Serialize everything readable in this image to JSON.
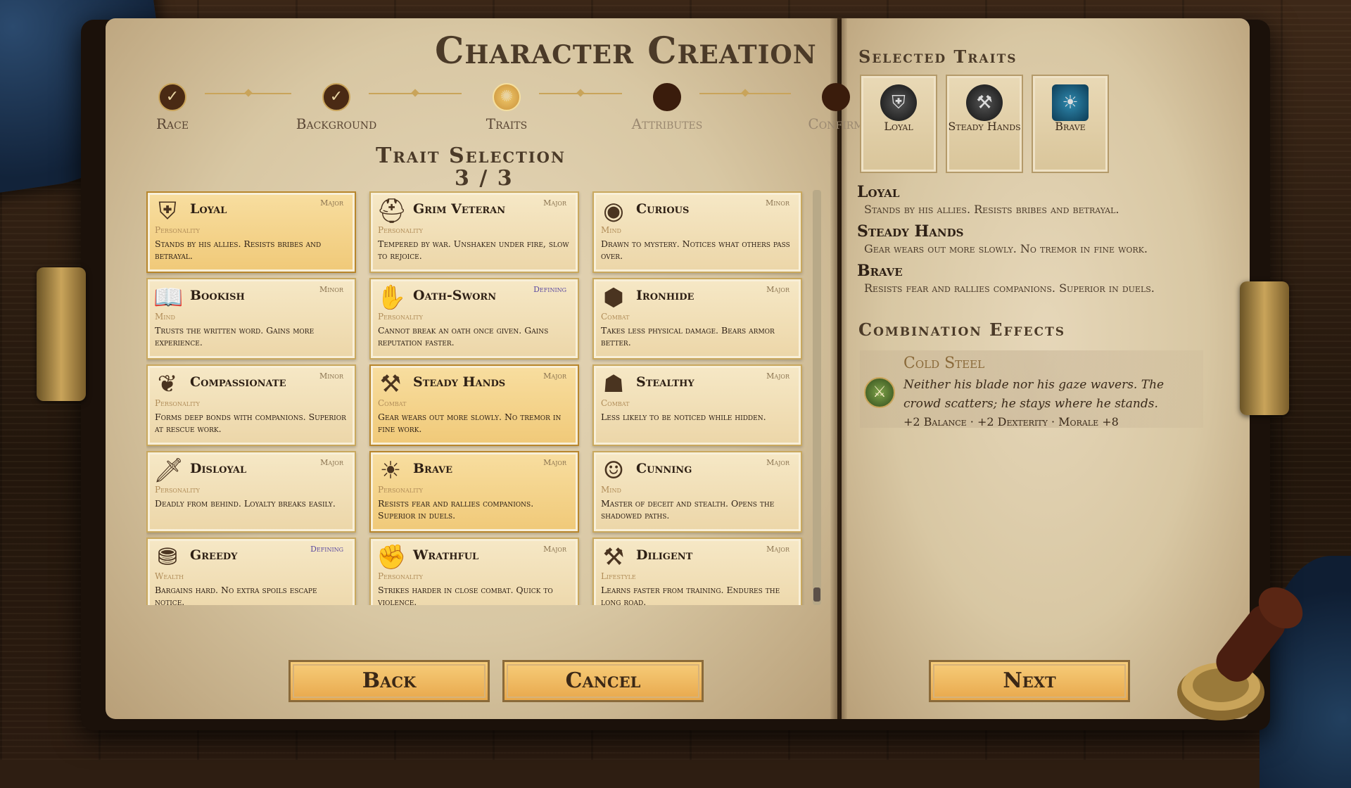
{
  "title": "Character Creation",
  "steps": [
    {
      "label": "Race",
      "state": "done",
      "mark": "✓"
    },
    {
      "label": "Background",
      "state": "done",
      "mark": "✓"
    },
    {
      "label": "Traits",
      "state": "active",
      "mark": "✺"
    },
    {
      "label": "Attributes",
      "state": "todo",
      "mark": ""
    },
    {
      "label": "Confirm",
      "state": "todo",
      "mark": ""
    }
  ],
  "trait_selection": {
    "heading": "Trait Selection",
    "count": "3 / 3"
  },
  "traits": [
    {
      "name": "Loyal",
      "weight": "Major",
      "category": "Personality",
      "desc": "Stands by his allies. Resists bribes and betrayal.",
      "icon": "shield-cross-icon",
      "glyph": "⛨",
      "selected": true
    },
    {
      "name": "Grim Veteran",
      "weight": "Major",
      "category": "Personality",
      "desc": "Tempered by war. Unshaken under fire, slow to rejoice.",
      "icon": "helmet-icon",
      "glyph": "⛑",
      "selected": false
    },
    {
      "name": "Curious",
      "weight": "Minor",
      "category": "Mind",
      "desc": "Drawn to mystery. Notices what others pass over.",
      "icon": "eye-icon",
      "glyph": "◉",
      "selected": false
    },
    {
      "name": "Bookish",
      "weight": "Minor",
      "category": "Mind",
      "desc": "Trusts the written word. Gains more experience.",
      "icon": "book-icon",
      "glyph": "📖",
      "selected": false
    },
    {
      "name": "Oath-Sworn",
      "weight": "Defining",
      "category": "Personality",
      "desc": "Cannot break an oath once given. Gains reputation faster.",
      "icon": "raised-hand-icon",
      "glyph": "✋",
      "selected": false
    },
    {
      "name": "Ironhide",
      "weight": "Major",
      "category": "Combat",
      "desc": "Takes less physical damage. Bears armor better.",
      "icon": "scale-armor-icon",
      "glyph": "⬢",
      "selected": false
    },
    {
      "name": "Compassionate",
      "weight": "Minor",
      "category": "Personality",
      "desc": "Forms deep bonds with companions. Superior at rescue work.",
      "icon": "wings-icon",
      "glyph": "❦",
      "selected": false
    },
    {
      "name": "Steady Hands",
      "weight": "Major",
      "category": "Combat",
      "desc": "Gear wears out more slowly. No tremor in fine work.",
      "icon": "anvil-icon",
      "glyph": "⚒",
      "selected": true
    },
    {
      "name": "Stealthy",
      "weight": "Major",
      "category": "Combat",
      "desc": "Less likely to be noticed while hidden.",
      "icon": "hood-icon",
      "glyph": "☗",
      "selected": false
    },
    {
      "name": "Disloyal",
      "weight": "Major",
      "category": "Personality",
      "desc": "Deadly from behind. Loyalty breaks easily.",
      "icon": "dagger-icon",
      "glyph": "🗡",
      "selected": false
    },
    {
      "name": "Brave",
      "weight": "Major",
      "category": "Personality",
      "desc": "Resists fear and rallies companions. Superior in duels.",
      "icon": "lion-icon",
      "glyph": "☀",
      "selected": true
    },
    {
      "name": "Cunning",
      "weight": "Major",
      "category": "Mind",
      "desc": "Master of deceit and stealth. Opens the shadowed paths.",
      "icon": "mask-icon",
      "glyph": "☺",
      "selected": false
    },
    {
      "name": "Greedy",
      "weight": "Defining",
      "category": "Wealth",
      "desc": "Bargains hard. No extra spoils escape notice.",
      "icon": "coins-icon",
      "glyph": "⛃",
      "selected": false
    },
    {
      "name": "Wrathful",
      "weight": "Major",
      "category": "Personality",
      "desc": "Strikes harder in close combat. Quick to violence.",
      "icon": "fist-icon",
      "glyph": "✊",
      "selected": false
    },
    {
      "name": "Diligent",
      "weight": "Major",
      "category": "Lifestyle",
      "desc": "Learns faster from training. Endures the long road.",
      "icon": "hammer-icon",
      "glyph": "⚒",
      "selected": false
    }
  ],
  "buttons": {
    "back": "Back",
    "cancel": "Cancel",
    "next": "Next"
  },
  "selected_traits": {
    "heading": "Selected Traits",
    "slots": [
      {
        "label": "Loyal",
        "icon": "dark-crest-icon",
        "glyph": "⛨"
      },
      {
        "label": "Steady Hands",
        "icon": "dark-crest-icon",
        "glyph": "⚒"
      },
      {
        "label": "Brave",
        "icon": "blue-crest-icon",
        "glyph": "☀"
      }
    ],
    "details": [
      {
        "name": "Loyal",
        "desc": "Stands by his allies. Resists bribes and betrayal."
      },
      {
        "name": "Steady Hands",
        "desc": "Gear wears out more slowly. No tremor in fine work."
      },
      {
        "name": "Brave",
        "desc": "Resists fear and rallies companions. Superior in duels."
      }
    ]
  },
  "combination": {
    "heading": "Combination Effects",
    "name": "Cold Steel",
    "text": "Neither his blade nor his gaze wavers. The crowd scatters; he stays where he stands.",
    "bonus": "+2 Balance · +2 Dexterity · Morale +8",
    "icon": "crossed-swords-icon"
  },
  "colors": {
    "accent": "#c9a45a",
    "selected_card": "#f0c978",
    "defining": "#5b4aa0"
  }
}
